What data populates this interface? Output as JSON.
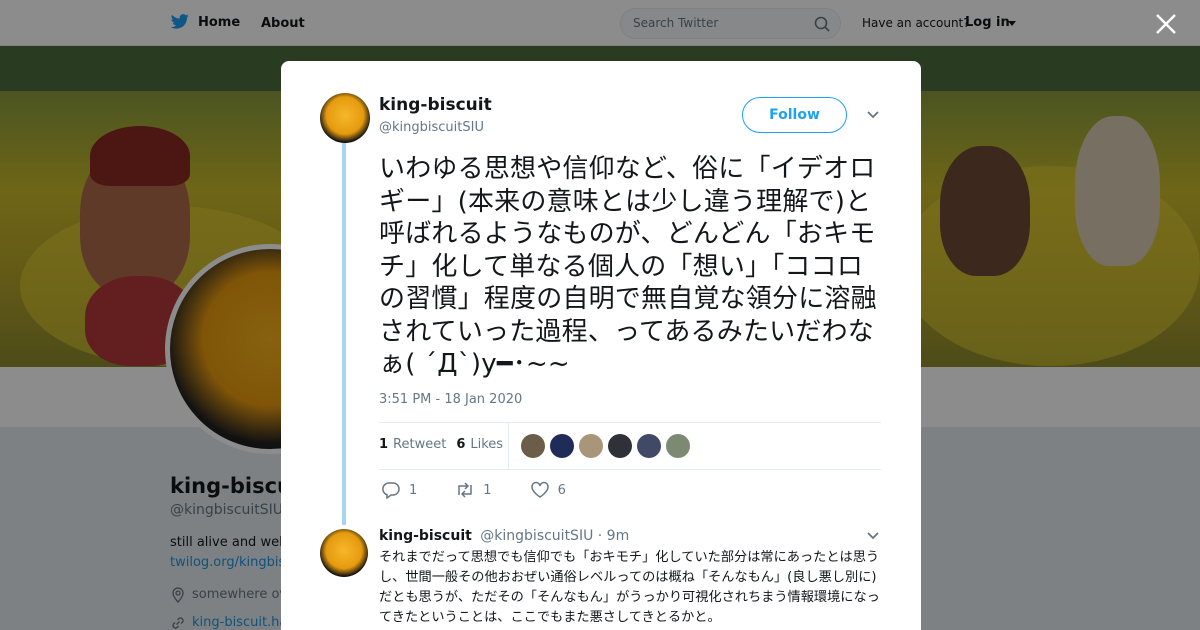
{
  "nav": {
    "home_label": "Home",
    "about_label": "About",
    "search_placeholder": "Search Twitter",
    "have_account": "Have an account?",
    "login_label": "Log in"
  },
  "profile": {
    "name": "king-biscuit",
    "handle": "@kingbiscuitSIU",
    "bio": "still alive and well.",
    "link": "twilog.org/kingbisc",
    "location": "somewhere ov",
    "link2": "king-biscuit.ha"
  },
  "tweet": {
    "author_name": "king-biscuit",
    "author_handle": "@kingbiscuitSIU",
    "follow_label": "Follow",
    "text": "いわゆる思想や信仰など、俗に「イデオロギー」(本来の意味とは少し違う理解で)と呼ばれるようなものが、どんどん「おキモチ」化して単なる個人の「想い」「ココロの習慣」程度の自明で無自覚な領分に溶融されていった過程、ってあるみたいだわなぁ( ´Д`)y━･~~",
    "timestamp": "3:51 PM - 18 Jan 2020",
    "retweet_count": "1",
    "retweet_label": "Retweet",
    "like_count": "6",
    "like_label": "Likes",
    "reply_action_count": "1",
    "retweet_action_count": "1",
    "like_action_count": "6",
    "liker_colors": [
      "#6b5d4a",
      "#1f2c5a",
      "#a8957a",
      "#2f3038",
      "#404a66",
      "#7d8a73"
    ]
  },
  "reply": {
    "author_name": "king-biscuit",
    "author_handle": "@kingbiscuitSIU",
    "time": "· 9m",
    "text": "それまでだって思想でも信仰でも「おキモチ」化していた部分は常にあったとは思うし、世間一般その他おおぜい通俗レベルってのは概ね「そんなもん」(良し悪し別に)だとも思うが、ただその「そんなもん」がうっかり可視化されちまう情報環境になってきたということは、ここでもまた悪さしてきとるかと。"
  },
  "colors": {
    "accent": "#1da1f2",
    "thread_line": "#a9d4f2",
    "text_secondary": "#657786"
  }
}
